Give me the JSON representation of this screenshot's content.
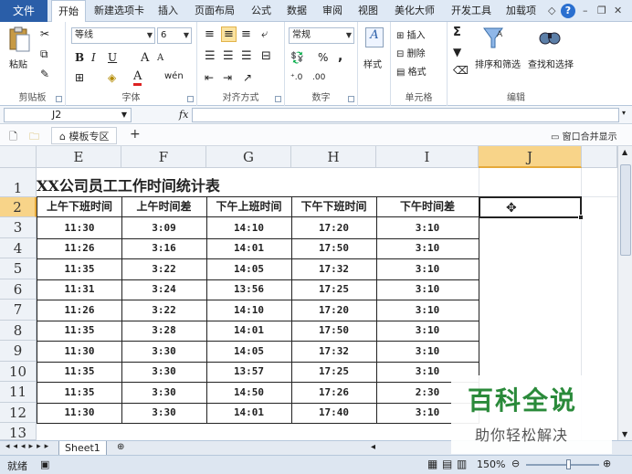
{
  "ribbon_tabs": {
    "file": "文件",
    "items": [
      "开始",
      "新建选项卡",
      "插入",
      "页面布局",
      "公式",
      "数据",
      "审阅",
      "视图",
      "美化大师",
      "开发工具",
      "加载项"
    ]
  },
  "ribbon": {
    "clipboard": {
      "paste": "粘贴",
      "label": "剪贴板"
    },
    "font": {
      "name": "等线",
      "size": "6",
      "label": "字体",
      "bold": "B",
      "italic": "I",
      "underline": "U",
      "grow": "A",
      "shrink": "A",
      "color_a": "A",
      "phonetic": "wén"
    },
    "align": {
      "label": "对齐方式"
    },
    "number": {
      "format": "常规",
      "percent": "%",
      "comma": ",",
      "label": "数字"
    },
    "styles": {
      "label": "样式"
    },
    "cells": {
      "insert": "插入",
      "delete": "删除",
      "format": "格式",
      "label": "单元格"
    },
    "editing": {
      "sort": "排序和筛选",
      "find": "查找和选择",
      "label": "编辑",
      "sigma": "Σ"
    }
  },
  "formula_bar": {
    "name_box": "J2",
    "fx": "fx",
    "value": ""
  },
  "template_bar": {
    "tab": "模板专区",
    "plus": "+",
    "merge": "窗口合并显示"
  },
  "sheet": {
    "columns": [
      "E",
      "F",
      "G",
      "H",
      "I",
      "J"
    ],
    "rows": [
      "1",
      "2",
      "3",
      "4",
      "5",
      "6",
      "7",
      "8",
      "9",
      "10",
      "11",
      "12",
      "13"
    ],
    "title": "XX公司员工工作时间统计表",
    "headers": [
      "上午下班时间",
      "上午时间差",
      "下午上班时间",
      "下午下班时间",
      "下午时间差"
    ],
    "data": [
      [
        "11:30",
        "3:09",
        "14:10",
        "17:20",
        "3:10"
      ],
      [
        "11:26",
        "3:16",
        "14:01",
        "17:50",
        "3:10"
      ],
      [
        "11:35",
        "3:22",
        "14:05",
        "17:32",
        "3:10"
      ],
      [
        "11:31",
        "3:24",
        "13:56",
        "17:25",
        "3:10"
      ],
      [
        "11:26",
        "3:22",
        "14:10",
        "17:20",
        "3:10"
      ],
      [
        "11:35",
        "3:28",
        "14:01",
        "17:50",
        "3:10"
      ],
      [
        "11:30",
        "3:30",
        "14:05",
        "17:32",
        "3:10"
      ],
      [
        "11:35",
        "3:30",
        "13:57",
        "17:25",
        "3:10"
      ],
      [
        "11:35",
        "3:30",
        "14:50",
        "17:26",
        "2:30"
      ],
      [
        "11:30",
        "3:30",
        "14:01",
        "17:40",
        "3:10"
      ]
    ],
    "selected_cell": "J2"
  },
  "sheet_tabs": {
    "active": "Sheet1"
  },
  "status": {
    "ready": "就绪",
    "zoom": "150%"
  },
  "watermark": {
    "big": "百科全说",
    "small": "助你轻松解决"
  },
  "colors": {
    "file_tab": "#2a5ea8",
    "selected_header": "#f8d489",
    "watermark_green": "#2a8a3a"
  }
}
